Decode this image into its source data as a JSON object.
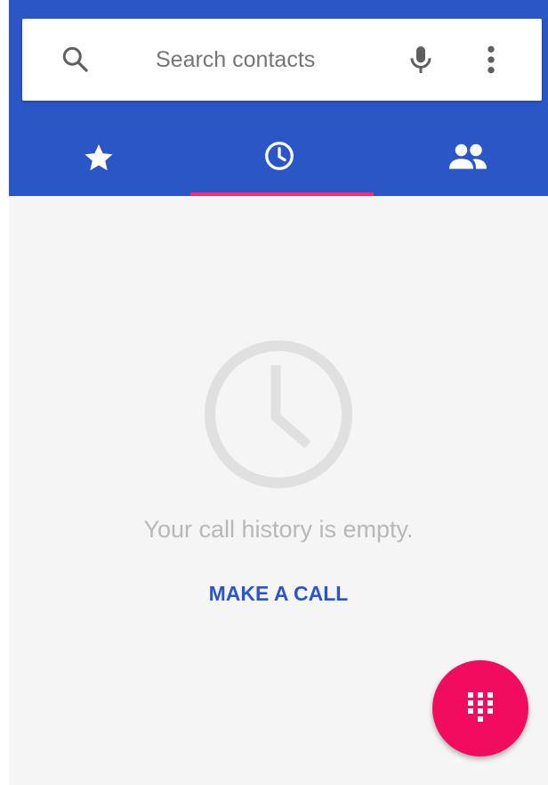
{
  "search": {
    "placeholder": "Search contacts",
    "search_icon": "search-icon",
    "voice_icon": "mic-icon",
    "menu_icon": "more-vert-icon"
  },
  "tabs": [
    {
      "icon": "star-icon",
      "selected": false
    },
    {
      "icon": "clock-icon",
      "selected": true
    },
    {
      "icon": "people-icon",
      "selected": false
    }
  ],
  "empty_state": {
    "icon": "clock-icon",
    "message": "Your call history is empty.",
    "action_label": "MAKE A CALL"
  },
  "fab": {
    "icon": "dialpad-icon"
  },
  "colors": {
    "primary": "#2a56c6",
    "accent": "#f20c5f",
    "indicator": "#ff2d6d",
    "background": "#f5f5f5",
    "empty_icon": "#e0e0e0",
    "empty_text": "#b8b8b8"
  }
}
